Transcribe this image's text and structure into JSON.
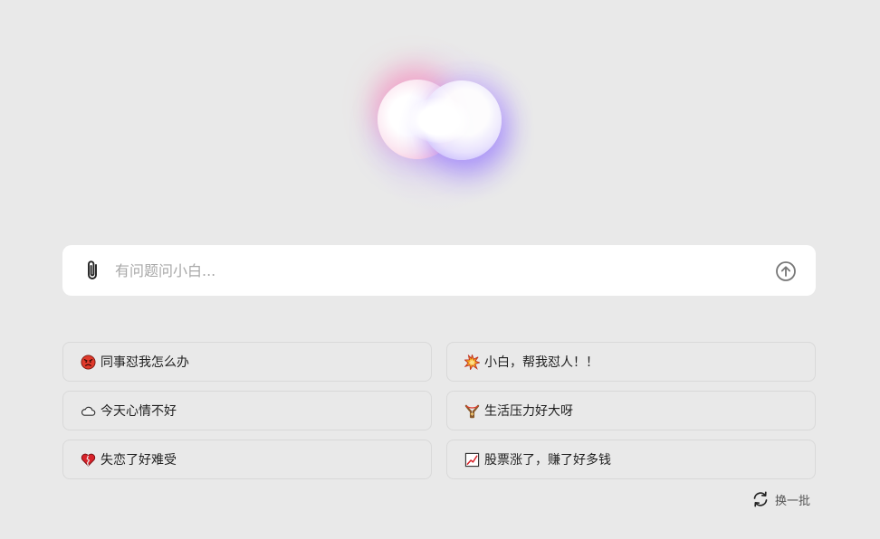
{
  "search": {
    "placeholder": "有问题问小白...",
    "attach_icon": "paperclip-icon",
    "send_icon": "arrow-up-circle-icon"
  },
  "suggestions": [
    {
      "icon": "angry-face-icon",
      "label": "同事怼我怎么办"
    },
    {
      "icon": "collision-icon",
      "label": "小白，帮我怼人！！"
    },
    {
      "icon": "cloud-icon",
      "label": "今天心情不好"
    },
    {
      "icon": "slingshot-icon",
      "label": "生活压力好大呀"
    },
    {
      "icon": "broken-heart-icon",
      "label": "失恋了好难受"
    },
    {
      "icon": "chart-increasing-icon",
      "label": "股票涨了，赚了好多钱"
    }
  ],
  "refresh": {
    "icon": "refresh-icon",
    "label": "换一批"
  },
  "colors": {
    "background": "#e9e9e9",
    "card": "#ffffff",
    "border": "#d9d9d9",
    "logo_pink": "#ff9fc5",
    "logo_purple": "#a896ff"
  }
}
